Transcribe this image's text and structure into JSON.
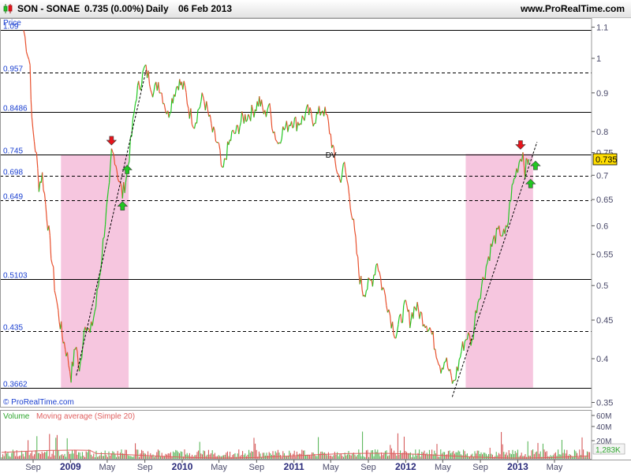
{
  "header": {
    "symbol": "SON - SONAE",
    "price_change": "0.735 (0.00%)",
    "period": "Daily",
    "date": "06 Feb 2013",
    "site": "www.ProRealTime.com"
  },
  "chart_data": {
    "type": "line",
    "title": "",
    "ylabel": "Price",
    "ylim": [
      0.335,
      1.12
    ],
    "scale": "log",
    "grid": false,
    "copyright": "© ProRealTime.com",
    "y_ticks": [
      "1.1",
      "1",
      "0.9",
      "0.8",
      "0.75",
      "0.7",
      "0.65",
      "0.6",
      "0.55",
      "0.5",
      "0.45",
      "0.4",
      "0.35"
    ],
    "x_axis": {
      "labels": [
        "Sep",
        "2009",
        "May",
        "Sep",
        "2010",
        "May",
        "Sep",
        "2011",
        "May",
        "Sep",
        "2012",
        "May",
        "Sep",
        "2013",
        "May"
      ],
      "year_labels": [
        "2009",
        "2010",
        "2011",
        "2012",
        "2013"
      ]
    },
    "levels": [
      {
        "label": "1.09",
        "value": 1.09,
        "style": "solid"
      },
      {
        "label": "0.957",
        "value": 0.957,
        "style": "dashed"
      },
      {
        "label": "0.8486",
        "value": 0.8486,
        "style": "solid"
      },
      {
        "label": "0.745",
        "value": 0.745,
        "style": "solid"
      },
      {
        "label": "0.698",
        "value": 0.698,
        "style": "dashed"
      },
      {
        "label": "0.649",
        "value": 0.649,
        "style": "dashed"
      },
      {
        "label": "0.5103",
        "value": 0.5103,
        "style": "solid"
      },
      {
        "label": "0.435",
        "value": 0.435,
        "style": "dashed"
      },
      {
        "label": "0.3662",
        "value": 0.3662,
        "style": "solid"
      }
    ],
    "last_price": "0.735",
    "annotation": "DV",
    "series": [
      {
        "price_path": [
          [
            "2008-08-01",
            1.09
          ],
          [
            "2008-08-10",
            1.04
          ],
          [
            "2008-08-22",
            0.98
          ],
          [
            "2008-08-28",
            0.82
          ],
          [
            "2008-09-12",
            0.74
          ],
          [
            "2008-09-20",
            0.68
          ],
          [
            "2008-10-01",
            0.7
          ],
          [
            "2008-10-12",
            0.64
          ],
          [
            "2008-10-26",
            0.57
          ],
          [
            "2008-11-10",
            0.5
          ],
          [
            "2008-11-22",
            0.46
          ],
          [
            "2008-12-05",
            0.43
          ],
          [
            "2008-12-18",
            0.41
          ],
          [
            "2009-01-03",
            0.38
          ],
          [
            "2009-01-20",
            0.42
          ],
          [
            "2009-01-30",
            0.38
          ],
          [
            "2009-02-18",
            0.45
          ],
          [
            "2009-03-06",
            0.43
          ],
          [
            "2009-03-25",
            0.47
          ],
          [
            "2009-04-10",
            0.53
          ],
          [
            "2009-04-25",
            0.61
          ],
          [
            "2009-05-08",
            0.67
          ],
          [
            "2009-05-15",
            0.75
          ],
          [
            "2009-05-26",
            0.74
          ],
          [
            "2009-06-08",
            0.69
          ],
          [
            "2009-06-20",
            0.66
          ],
          [
            "2009-07-04",
            0.7
          ],
          [
            "2009-07-20",
            0.79
          ],
          [
            "2009-08-05",
            0.9
          ],
          [
            "2009-08-18",
            0.93
          ],
          [
            "2009-09-01",
            0.97
          ],
          [
            "2009-09-16",
            0.94
          ],
          [
            "2009-09-30",
            0.9
          ],
          [
            "2009-10-15",
            0.93
          ],
          [
            "2009-10-30",
            0.89
          ],
          [
            "2009-11-15",
            0.84
          ],
          [
            "2009-12-05",
            0.9
          ],
          [
            "2009-12-20",
            0.93
          ],
          [
            "2010-01-10",
            0.91
          ],
          [
            "2010-01-25",
            0.85
          ],
          [
            "2010-02-10",
            0.82
          ],
          [
            "2010-02-25",
            0.86
          ],
          [
            "2010-03-10",
            0.89
          ],
          [
            "2010-03-25",
            0.85
          ],
          [
            "2010-04-10",
            0.8
          ],
          [
            "2010-05-01",
            0.76
          ],
          [
            "2010-05-12",
            0.7
          ],
          [
            "2010-05-26",
            0.75
          ],
          [
            "2010-06-12",
            0.79
          ],
          [
            "2010-06-28",
            0.8
          ],
          [
            "2010-07-15",
            0.83
          ],
          [
            "2010-08-01",
            0.84
          ],
          [
            "2010-08-20",
            0.85
          ],
          [
            "2010-09-10",
            0.88
          ],
          [
            "2010-09-28",
            0.84
          ],
          [
            "2010-10-10",
            0.87
          ],
          [
            "2010-10-25",
            0.81
          ],
          [
            "2010-11-10",
            0.77
          ],
          [
            "2010-11-22",
            0.8
          ],
          [
            "2010-12-08",
            0.81
          ],
          [
            "2010-12-24",
            0.83
          ],
          [
            "2011-01-10",
            0.82
          ],
          [
            "2011-01-28",
            0.83
          ],
          [
            "2011-02-15",
            0.85
          ],
          [
            "2011-03-05",
            0.83
          ],
          [
            "2011-03-20",
            0.84
          ],
          [
            "2011-04-05",
            0.86
          ],
          [
            "2011-04-20",
            0.83
          ],
          [
            "2011-05-01",
            0.79
          ],
          [
            "2011-05-15",
            0.73
          ],
          [
            "2011-05-30",
            0.69
          ],
          [
            "2011-06-15",
            0.72
          ],
          [
            "2011-07-01",
            0.66
          ],
          [
            "2011-07-15",
            0.6
          ],
          [
            "2011-08-01",
            0.52
          ],
          [
            "2011-08-15",
            0.49
          ],
          [
            "2011-09-01",
            0.5
          ],
          [
            "2011-09-15",
            0.51
          ],
          [
            "2011-09-30",
            0.54
          ],
          [
            "2011-10-15",
            0.5
          ],
          [
            "2011-10-30",
            0.48
          ],
          [
            "2011-11-15",
            0.45
          ],
          [
            "2011-11-30",
            0.43
          ],
          [
            "2011-12-15",
            0.45
          ],
          [
            "2012-01-01",
            0.47
          ],
          [
            "2012-01-15",
            0.45
          ],
          [
            "2012-02-01",
            0.47
          ],
          [
            "2012-02-15",
            0.46
          ],
          [
            "2012-03-01",
            0.45
          ],
          [
            "2012-03-20",
            0.44
          ],
          [
            "2012-04-10",
            0.41
          ],
          [
            "2012-04-25",
            0.39
          ],
          [
            "2012-05-10",
            0.4
          ],
          [
            "2012-05-25",
            0.38
          ],
          [
            "2012-06-05",
            0.37
          ],
          [
            "2012-06-20",
            0.39
          ],
          [
            "2012-07-01",
            0.41
          ],
          [
            "2012-07-20",
            0.43
          ],
          [
            "2012-08-05",
            0.42
          ],
          [
            "2012-08-20",
            0.47
          ],
          [
            "2012-09-05",
            0.5
          ],
          [
            "2012-09-20",
            0.53
          ],
          [
            "2012-10-05",
            0.56
          ],
          [
            "2012-10-20",
            0.58
          ],
          [
            "2012-11-05",
            0.59
          ],
          [
            "2012-11-20",
            0.58
          ],
          [
            "2012-12-01",
            0.61
          ],
          [
            "2012-12-10",
            0.66
          ],
          [
            "2012-12-20",
            0.69
          ],
          [
            "2013-01-01",
            0.72
          ],
          [
            "2013-01-10",
            0.74
          ],
          [
            "2013-01-18",
            0.75
          ],
          [
            "2013-01-25",
            0.71
          ],
          [
            "2013-02-01",
            0.73
          ],
          [
            "2013-02-06",
            0.735
          ]
        ]
      }
    ],
    "trendlines": [
      {
        "from": [
          "2009-01-20",
          0.38
        ],
        "to": [
          "2009-09-05",
          0.965
        ]
      },
      {
        "from": [
          "2012-06-01",
          0.356
        ],
        "to": [
          "2013-03-05",
          0.775
        ]
      }
    ],
    "highlight_zones": [
      {
        "from": "2008-12-01",
        "to": "2009-07-10",
        "top": 0.745,
        "bottom": 0.3662
      },
      {
        "from": "2012-07-15",
        "to": "2013-02-20",
        "top": 0.747,
        "bottom": 0.3662
      }
    ],
    "arrows": [
      {
        "date": "2009-05-15",
        "value": 0.775,
        "direction": "down",
        "color": "#e8141b"
      },
      {
        "date": "2009-07-05",
        "value": 0.715,
        "direction": "up",
        "color": "#22c722"
      },
      {
        "date": "2009-06-20",
        "value": 0.64,
        "direction": "up",
        "color": "#22c722"
      },
      {
        "date": "2013-01-10",
        "value": 0.765,
        "direction": "down",
        "color": "#e8141b"
      },
      {
        "date": "2013-02-12",
        "value": 0.685,
        "direction": "up",
        "color": "#22c722"
      },
      {
        "date": "2013-02-28",
        "value": 0.724,
        "direction": "up",
        "color": "#22c722"
      }
    ],
    "volume_panel": {
      "label": "Volume",
      "ma_label": "Moving average (Simple 20)",
      "y_ticks": [
        "60M",
        "40M",
        "20M"
      ],
      "last_value": "1,283K"
    },
    "colors": {
      "up": "#22c722",
      "down": "#e8502d",
      "highlight": "#f4bcd9",
      "last_price_tag": "#ffdd00",
      "level_label": "#1a3fd0",
      "volume_label": "#2ea62e",
      "ma_label": "#e06060"
    }
  }
}
